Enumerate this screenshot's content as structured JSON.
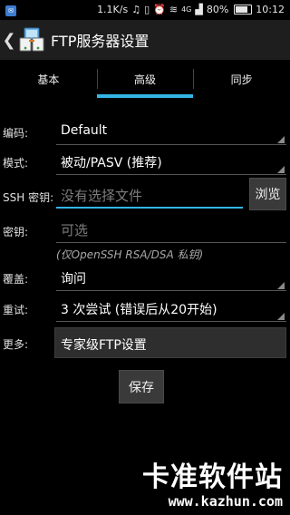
{
  "status_bar": {
    "speed": "1.1K/s",
    "network": "4G",
    "battery": "80%",
    "battery_level": 0.8,
    "time": "10:12"
  },
  "action_bar": {
    "back_icon": "chevron-left-icon",
    "app_icon": "ftp-app-icon",
    "title": "FTP服务器设置"
  },
  "tabs": [
    {
      "label": "基本",
      "active": false
    },
    {
      "label": "高级",
      "active": true
    },
    {
      "label": "同步",
      "active": false
    }
  ],
  "form": {
    "encoding": {
      "label": "编码:",
      "value": "Default"
    },
    "mode": {
      "label": "模式:",
      "value": "被动/PASV (推荐)"
    },
    "ssh_key": {
      "label": "SSH 密钥:",
      "placeholder": "没有选择文件",
      "browse": "浏览"
    },
    "passphrase": {
      "label": "密钥:",
      "placeholder": "可选"
    },
    "hint": "(仅OpenSSH RSA/DSA 私钥)",
    "overwrite": {
      "label": "覆盖:",
      "value": "询问"
    },
    "retry": {
      "label": "重试:",
      "value": "3 次尝试 (错误后从20开始)"
    },
    "more": {
      "label": "更多:",
      "value": "专家级FTP设置"
    },
    "save": "保存"
  },
  "watermark": {
    "text": "卡准软件站",
    "url": "www.kazhun.com"
  },
  "colors": {
    "accent": "#33b5e5",
    "background": "#000000",
    "action_bar": "#1e1e1e"
  }
}
